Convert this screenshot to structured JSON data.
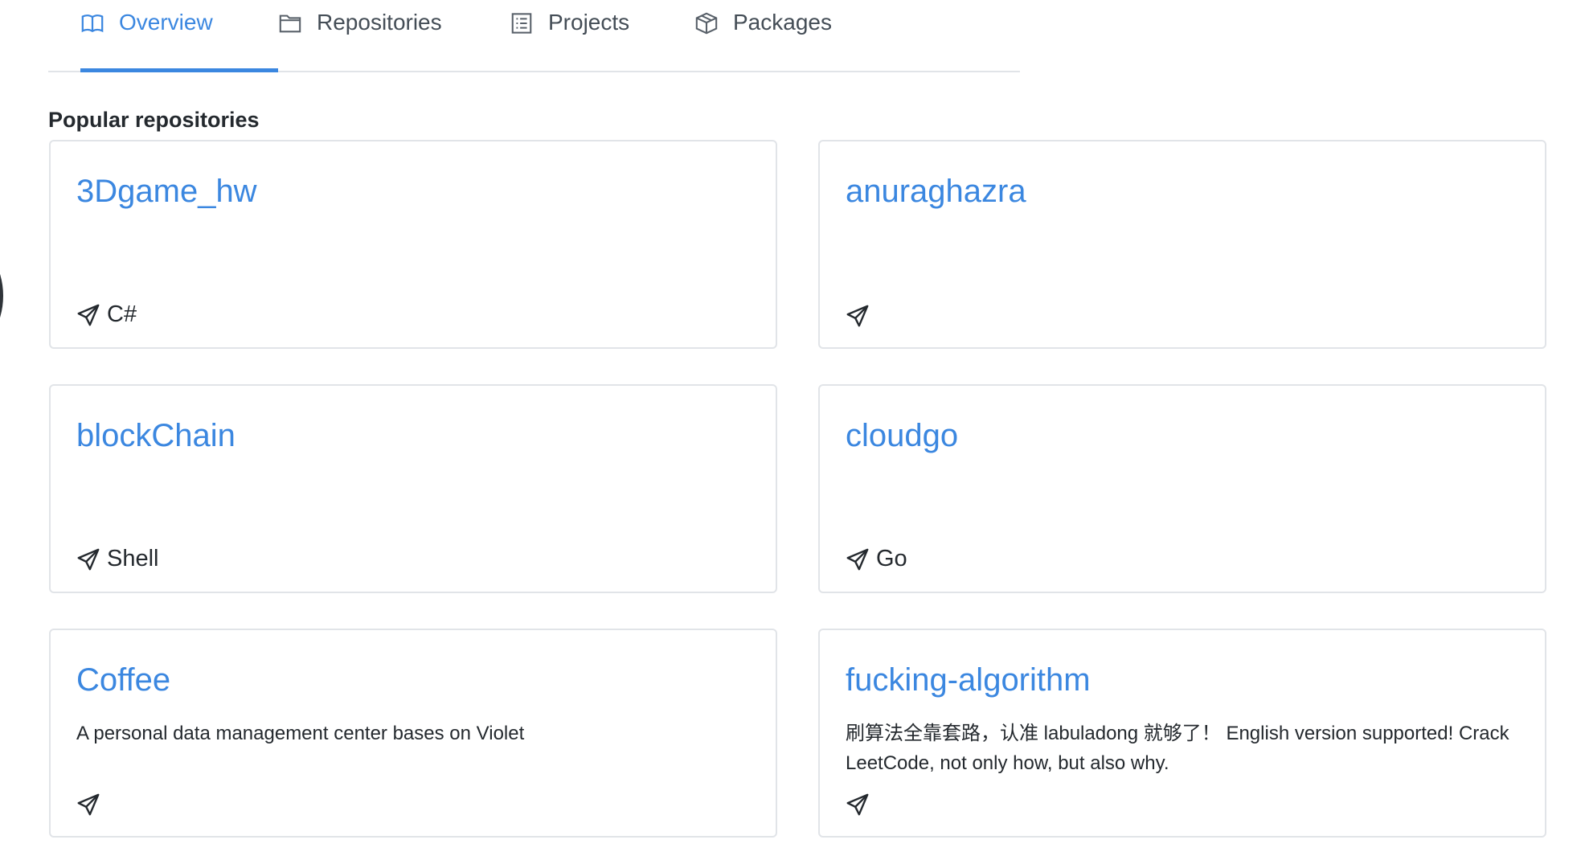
{
  "tabs": [
    {
      "label": "Overview",
      "icon": "book-icon",
      "active": true
    },
    {
      "label": "Repositories",
      "icon": "folder-icon",
      "active": false
    },
    {
      "label": "Projects",
      "icon": "project-board-icon",
      "active": false
    },
    {
      "label": "Packages",
      "icon": "package-icon",
      "active": false
    }
  ],
  "section": {
    "title": "Popular repositories"
  },
  "repos": [
    {
      "name": "3Dgame_hw",
      "description": "",
      "language": "C#"
    },
    {
      "name": "anuraghazra",
      "description": "",
      "language": ""
    },
    {
      "name": "blockChain",
      "description": "",
      "language": "Shell"
    },
    {
      "name": "cloudgo",
      "description": "",
      "language": "Go"
    },
    {
      "name": "Coffee",
      "description": "A personal data management center bases on Violet",
      "language": ""
    },
    {
      "name": "fucking-algorithm",
      "description": "刷算法全靠套路，认准 labuladong 就够了！ English version supported! Crack LeetCode, not only how, but also why.",
      "language": ""
    }
  ],
  "colors": {
    "accent": "#3b87e0",
    "border": "#e1e4e8",
    "text": "#24292e"
  }
}
